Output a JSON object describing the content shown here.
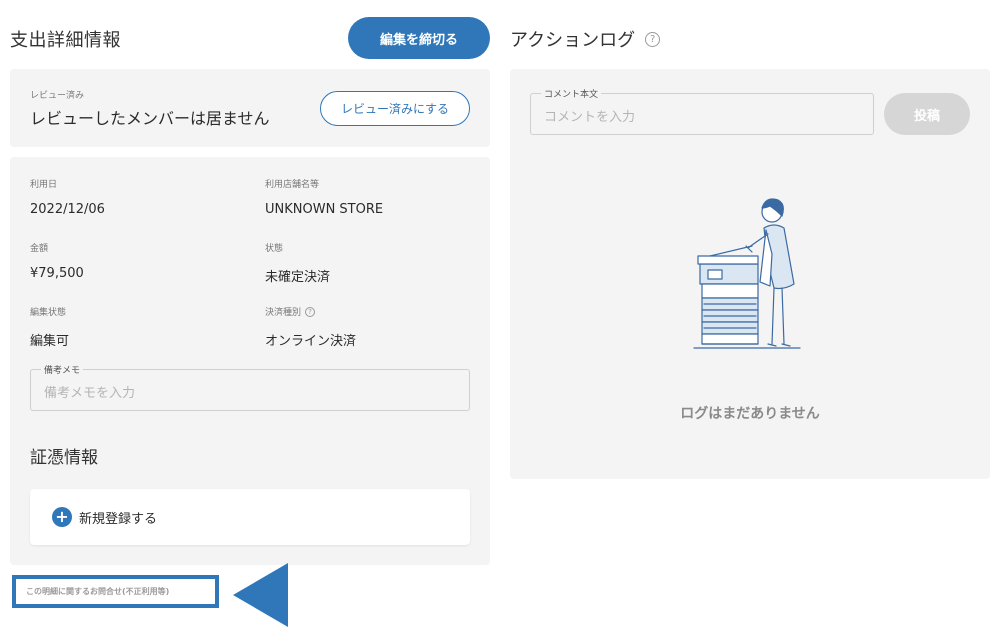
{
  "expense_detail": {
    "title": "支出詳細情報",
    "close_edit_button": "編集を締切る"
  },
  "review": {
    "small_label": "レビュー済み",
    "status_text": "レビューしたメンバーは居ません",
    "mark_reviewed_button": "レビュー済みにする"
  },
  "fields": {
    "usage_date": {
      "label": "利用日",
      "value": "2022/12/06"
    },
    "store_name": {
      "label": "利用店舗名等",
      "value": "UNKNOWN STORE"
    },
    "amount": {
      "label": "金額",
      "value": "¥79,500"
    },
    "status": {
      "label": "状態",
      "value": "未確定決済"
    },
    "edit_status": {
      "label": "編集状態",
      "value": "編集可"
    },
    "payment_type": {
      "label": "決済種別",
      "value": "オンライン決済",
      "help_glyph": "?"
    }
  },
  "memo": {
    "legend": "備考メモ",
    "placeholder": "備考メモを入力"
  },
  "evidence": {
    "title": "証憑情報",
    "new_register_label": "新規登録する",
    "plus_glyph": "+"
  },
  "inquiry": {
    "text": "この明細に関するお問合せ(不正利用等)"
  },
  "action_log": {
    "title": "アクションログ",
    "help_glyph": "?",
    "comment_legend": "コメント本文",
    "comment_placeholder": "コメントを入力",
    "post_button": "投稿",
    "empty_text": "ログはまだありません"
  },
  "colors": {
    "primary": "#2f77b8",
    "card_background": "#f4f4f4",
    "disabled_button": "#d6d6d6",
    "illustration_line": "#3b6aa3",
    "illustration_fill": "#dbe6f3"
  },
  "icons": {
    "help": "help-circle-icon",
    "plus": "plus-circle-icon",
    "illustration": "person-at-copier-illustration"
  }
}
